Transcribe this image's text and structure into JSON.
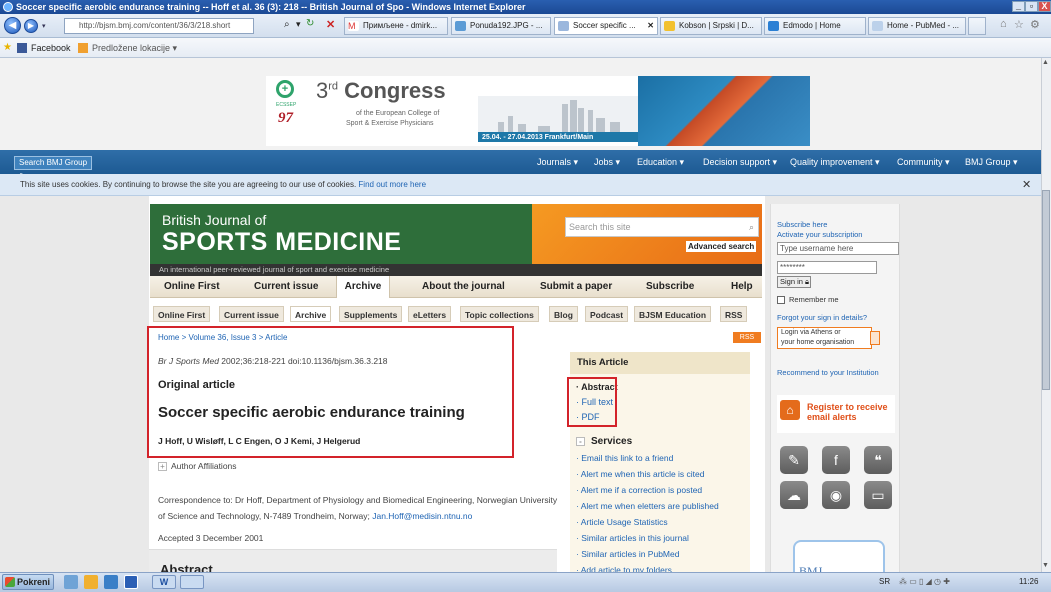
{
  "window": {
    "title": "Soccer specific aerobic endurance training -- Hoff et al. 36 (3): 218 -- British Journal of Spo - Windows Internet Explorer",
    "minimize": "_",
    "restore": "̱̲",
    "close": "X"
  },
  "browser": {
    "address": "http://bjsm.bmj.com/content/36/3/218.short",
    "tabs": [
      {
        "label": "Примљене - dmirk...",
        "color": "#d33"
      },
      {
        "label": "Ponuda192.JPG - ...",
        "color": "#5b9bd5"
      },
      {
        "label": "Soccer specific ...",
        "color": "#9bb7dd"
      },
      {
        "label": "Kobson | Srpski | D...",
        "color": "#f2c12e"
      },
      {
        "label": "Edmodo | Home",
        "color": "#2a7fd4"
      },
      {
        "label": "Home - PubMed - ...",
        "color": "#bcd1ea"
      }
    ],
    "favorites": [
      {
        "label": "Facebook",
        "color": "#3b5998"
      },
      {
        "label": "Predložene lokacije ▾",
        "color": "#f0a030"
      }
    ]
  },
  "congress": {
    "title_prefix": "3",
    "title_sup": "rd",
    "title": "Congress",
    "sub1": "of the European College of",
    "sub2": "Sport & Exercise Physicians",
    "dates": "25.04. - 27.04.2013 Frankfurt/Main",
    "logo_text": "ECSSEP"
  },
  "bmjnav": {
    "search_label": "Search BMJ Group",
    "items": [
      "Journals ▾",
      "Jobs ▾",
      "Education ▾",
      "Decision support ▾",
      "Quality improvement ▾",
      "Community ▾",
      "BMJ Group ▾"
    ]
  },
  "cookie": {
    "text": "This site uses cookies. By continuing to browse the site you are agreeing to our use of cookies.",
    "link": "Find out more here",
    "close": "✕"
  },
  "journal": {
    "name_top": "British Journal of",
    "name_bottom": "SPORTS MEDICINE",
    "tagline": "An international peer-reviewed journal of sport and exercise medicine",
    "search_placeholder": "Search this site",
    "advanced": "Advanced search",
    "nav": [
      "Online First",
      "Current issue",
      "Archive",
      "About the journal",
      "Submit a paper",
      "Subscribe",
      "Help"
    ],
    "subnav": [
      "Online First",
      "Current issue",
      "Archive",
      "Supplements",
      "eLetters",
      "Topic collections",
      "Blog",
      "Podcast",
      "BJSM Education",
      "RSS"
    ]
  },
  "article": {
    "breadcrumb": "Home > Volume 36, Issue 3 > Article",
    "rss": "RSS",
    "citation_journal": "Br J Sports Med",
    "citation_rest": " 2002;36:218-221 doi:10.1136/bjsm.36.3.218",
    "type": "Original article",
    "title": "Soccer specific aerobic endurance training",
    "authors": "J Hoff, U Wisløff, L C Engen, O J Kemi, J Helgerud",
    "affiliations": "Author Affiliations",
    "correspondence": "Correspondence to: Dr Hoff, Department of Physiology and Biomedical Engineering, Norwegian University of Science and Technology, N-7489 Trondheim, Norway;",
    "email": "Jan.Hoff@medisin.ntnu.no",
    "accepted": "Accepted 3 December 2001",
    "abstract_heading": "Abstract"
  },
  "this_article": {
    "heading": "This Article",
    "links": [
      "Abstract",
      "Full text",
      "PDF"
    ],
    "services_heading": "Services",
    "services": [
      "Email this link to a friend",
      "Alert me when this article is cited",
      "Alert me if a correction is posted",
      "Alert me when eletters are published",
      "Article Usage Statistics",
      "Similar articles in this journal",
      "Similar articles in PubMed",
      "Add article to my folders"
    ]
  },
  "sidebar": {
    "subscribe": "Subscribe here",
    "activate": "Activate your subscription",
    "username_placeholder": "Type username here",
    "password": "********",
    "signin": "Sign in",
    "remember": "Remember me",
    "forgot": "Forgot your sign in details?",
    "athens1": "Login via Athens or",
    "athens2": "your home organisation",
    "recommend": "Recommend to your Institution",
    "register1": "Register to receive",
    "register2": "email alerts",
    "ad": "BMJ"
  },
  "taskbar": {
    "start": "Pokreni",
    "lang": "SR",
    "time": "11:26"
  }
}
